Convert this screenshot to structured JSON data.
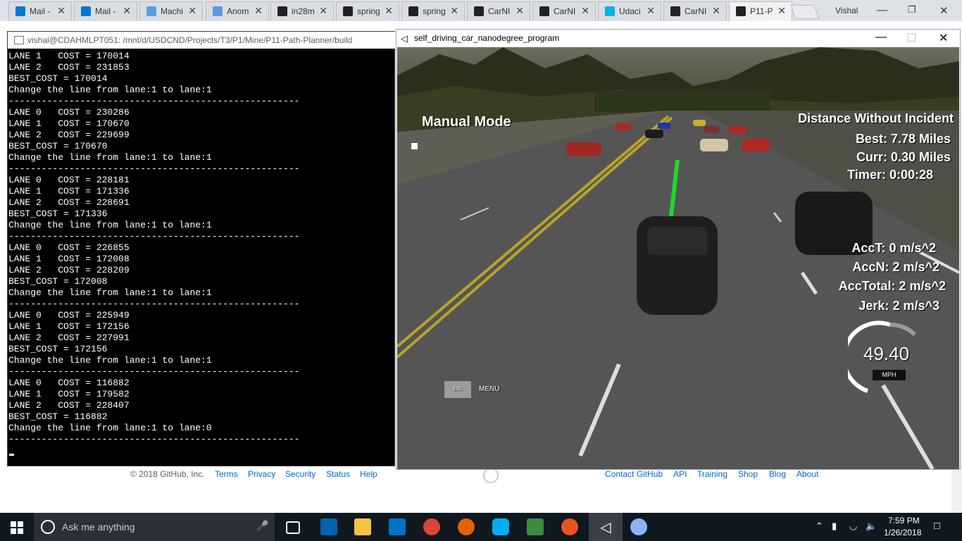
{
  "browser": {
    "tabs": [
      {
        "label": "Mail -",
        "color": "#0078d4"
      },
      {
        "label": "Mail -",
        "color": "#0078d4"
      },
      {
        "label": "Machi",
        "color": "#5f9bdc"
      },
      {
        "label": "Anom",
        "color": "#5f9bdc"
      },
      {
        "label": "in28m",
        "color": "#222222"
      },
      {
        "label": "spring",
        "color": "#222222"
      },
      {
        "label": "spring",
        "color": "#222222"
      },
      {
        "label": "CarNI",
        "color": "#222222"
      },
      {
        "label": "CarNI",
        "color": "#222222"
      },
      {
        "label": "Udaci",
        "color": "#02b3e4"
      },
      {
        "label": "CarNI",
        "color": "#222222"
      },
      {
        "label": "P11-P",
        "color": "#222222"
      }
    ],
    "profile": "Vishal"
  },
  "github_footer": {
    "copyright": "© 2018 GitHub, Inc.",
    "links_left": [
      "Terms",
      "Privacy",
      "Security",
      "Status",
      "Help"
    ],
    "links_right": [
      "Contact GitHub",
      "API",
      "Training",
      "Shop",
      "Blog",
      "About"
    ]
  },
  "terminal": {
    "title": "vishal@CDAHMLPT051: /mnt/d/USDCND/Projects/T3/P1/Mine/P11-Path-Planner/build",
    "lines": [
      "LANE 1   COST = 170014",
      "LANE 2   COST = 231853",
      "BEST_COST = 170014",
      "Change the line from lane:1 to lane:1",
      "-----------------------------------------------------",
      "LANE 0   COST = 230286",
      "LANE 1   COST = 170670",
      "LANE 2   COST = 229699",
      "BEST_COST = 170670",
      "Change the line from lane:1 to lane:1",
      "-----------------------------------------------------",
      "LANE 0   COST = 228181",
      "LANE 1   COST = 171336",
      "LANE 2   COST = 228691",
      "BEST_COST = 171336",
      "Change the line from lane:1 to lane:1",
      "-----------------------------------------------------",
      "LANE 0   COST = 226855",
      "LANE 1   COST = 172008",
      "LANE 2   COST = 228209",
      "BEST_COST = 172008",
      "Change the line from lane:1 to lane:1",
      "-----------------------------------------------------",
      "LANE 0   COST = 225949",
      "LANE 1   COST = 172156",
      "LANE 2   COST = 227991",
      "BEST_COST = 172156",
      "Change the line from lane:1 to lane:1",
      "-----------------------------------------------------",
      "LANE 0   COST = 116882",
      "LANE 1   COST = 179582",
      "LANE 2   COST = 228407",
      "BEST_COST = 116882",
      "Change the line from lane:1 to lane:0",
      "-----------------------------------------------------"
    ]
  },
  "game": {
    "title": "self_driving_car_nanodegree_program",
    "manual_mode": "Manual Mode",
    "distance_title": "Distance Without Incident",
    "best": "Best: 7.78 Miles",
    "curr": "Curr: 0.30 Miles",
    "timer": "Timer: 0:00:28",
    "acct": "AccT: 0 m/s^2",
    "accn": "AccN: 2 m/s^2",
    "acctotal": "AccTotal: 2 m/s^2",
    "jerk": "Jerk: 2 m/s^3",
    "speed": "49.40",
    "speed_unit": "MPH",
    "esc_key": "ESC",
    "menu": "MENU"
  },
  "taskbar": {
    "search_placeholder": "Ask me anything",
    "time": "7:59 PM",
    "date": "1/26/2018"
  }
}
